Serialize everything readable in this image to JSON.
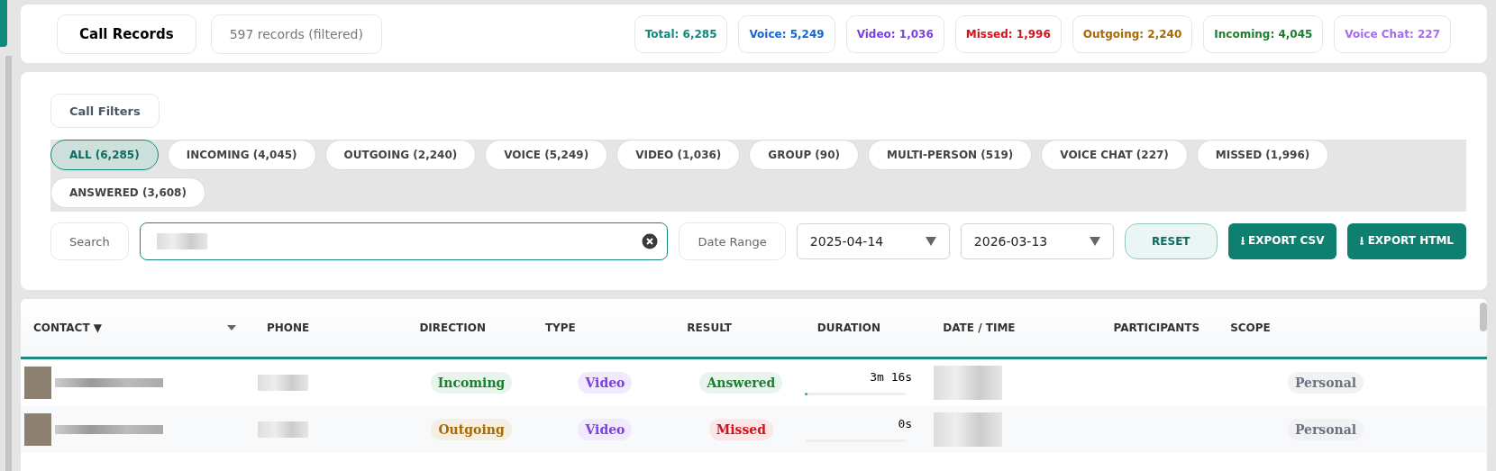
{
  "header": {
    "title": "Call Records",
    "record_count": "597 records (filtered)",
    "stats": [
      {
        "label": "Total: 6,285",
        "color": "#0f8a7a"
      },
      {
        "label": "Voice: 5,249",
        "color": "#1565d8"
      },
      {
        "label": "Video: 1,036",
        "color": "#7b3fe4"
      },
      {
        "label": "Missed: 1,996",
        "color": "#d3121c"
      },
      {
        "label": "Outgoing: 2,240",
        "color": "#a86a00"
      },
      {
        "label": "Incoming: 4,045",
        "color": "#1c7f2e"
      },
      {
        "label": "Voice Chat: 227",
        "color": "#a56cf0"
      }
    ]
  },
  "filters": {
    "title": "Call Filters",
    "chips": [
      {
        "label": "ALL (6,285)",
        "selected": true
      },
      {
        "label": "INCOMING (4,045)",
        "selected": false
      },
      {
        "label": "OUTGOING (2,240)",
        "selected": false
      },
      {
        "label": "VOICE (5,249)",
        "selected": false
      },
      {
        "label": "VIDEO (1,036)",
        "selected": false
      },
      {
        "label": "GROUP (90)",
        "selected": false
      },
      {
        "label": "MULTI-PERSON (519)",
        "selected": false
      },
      {
        "label": "VOICE CHAT (227)",
        "selected": false
      },
      {
        "label": "MISSED (1,996)",
        "selected": false
      },
      {
        "label": "ANSWERED (3,608)",
        "selected": false
      }
    ],
    "search_label": "Search",
    "date_range_label": "Date Range",
    "start_date": "2025-04-14",
    "end_date": "2026-03-13",
    "buttons": [
      {
        "label": "RESET",
        "kind": "reset"
      },
      {
        "label": "⭳ EXPORT CSV",
        "kind": "export"
      },
      {
        "label": "⭳ EXPORT HTML",
        "kind": "export"
      }
    ]
  },
  "table": {
    "columns": [
      {
        "label": "CONTACT ▼",
        "dropdown": true
      },
      {
        "label": "PHONE",
        "dropdown": false
      },
      {
        "label": "DIRECTION",
        "dropdown": false
      },
      {
        "label": "TYPE",
        "dropdown": false
      },
      {
        "label": "RESULT",
        "dropdown": false
      },
      {
        "label": "DURATION",
        "dropdown": false
      },
      {
        "label": "DATE / TIME",
        "dropdown": false
      },
      {
        "label": "PARTICIPANTS",
        "dropdown": false
      },
      {
        "label": "SCOPE",
        "dropdown": false
      }
    ],
    "rows": [
      {
        "direction": {
          "label": "Incoming",
          "kind": "incoming"
        },
        "type": {
          "label": "Video",
          "kind": "video"
        },
        "result": {
          "label": "Answered",
          "kind": "answered"
        },
        "duration": "3m 16s",
        "level": 0.03,
        "scope": {
          "label": "Personal",
          "kind": "personal"
        }
      },
      {
        "direction": {
          "label": "Outgoing",
          "kind": "outgoing"
        },
        "type": {
          "label": "Video",
          "kind": "video"
        },
        "result": {
          "label": "Missed",
          "kind": "missed"
        },
        "duration": "0s",
        "level": 0,
        "scope": {
          "label": "Personal",
          "kind": "personal"
        }
      }
    ]
  }
}
